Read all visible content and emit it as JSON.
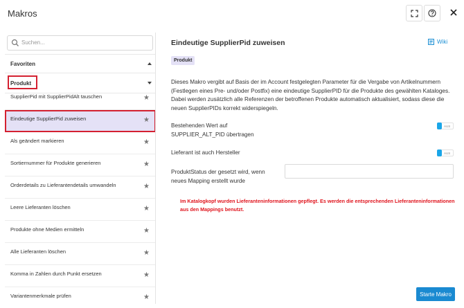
{
  "window": {
    "title": "Makros"
  },
  "search": {
    "placeholder": "Suchen..."
  },
  "sections": {
    "favoriten": "Favoriten",
    "produkt": "Produkt"
  },
  "macros": [
    {
      "label": "SupplierPid mit SupplierPidAlt tauschen"
    },
    {
      "label": "Eindeutige SupplierPid zuweisen",
      "active": true
    },
    {
      "label": "Als geändert markieren"
    },
    {
      "label": "Sortiernummer für Produkte generieren"
    },
    {
      "label": "Orderdetails zu Lieferantendetails umwandeln"
    },
    {
      "label": "Leere Lieferanten löschen"
    },
    {
      "label": "Produkte ohne Medien ermitteln"
    },
    {
      "label": "Alle Lieferanten löschen"
    },
    {
      "label": "Komma in Zahlen durch Punkt ersetzen"
    },
    {
      "label": "Variantenmerkmale prüfen"
    }
  ],
  "detail": {
    "title": "Eindeutige SupplierPid zuweisen",
    "wiki": "Wiki",
    "badge": "Produkt",
    "description": "Dieses Makro vergibt auf Basis der im Account festgelegten Parameter für die Vergabe von Artikelnummern (Festlegen eines Pre- und/oder Postfix) eine eindeutige SupplierPID für die Produkte des gewählten Kataloges. Dabei werden zusätzlich alle Referenzen der betroffenen Produkte automatisch aktualisiert, sodass diese die neuen SupplierPIDs korrekt widerspiegeln.",
    "option1_line1": "Bestehenden Wert auf",
    "option1_line2": "SUPPLIER_ALT_PID übertragen",
    "option1_toggle": "AUS",
    "option2": "Lieferant ist auch Hersteller",
    "option2_toggle": "AUS",
    "status_line1": "ProduktStatus der gesetzt wird, wenn",
    "status_line2": "neues Mapping erstellt wurde",
    "status_value": "",
    "warning": "Im Katalogkopf wurden Lieferanteninformationen gepflegt. Es werden die entsprechenden Lieferanteninformationen aus den Mappings benutzt.",
    "start_button": "Starte Makro"
  },
  "colors": {
    "accent": "#1a8ad1",
    "highlight": "#e4e1f6",
    "annotation": "#d42030",
    "warning": "#e0141d"
  },
  "icons": [
    "fullscreen-icon",
    "help-icon",
    "close-icon",
    "search-icon",
    "chevron-up-icon",
    "chevron-down-icon",
    "star-icon",
    "book-icon"
  ]
}
